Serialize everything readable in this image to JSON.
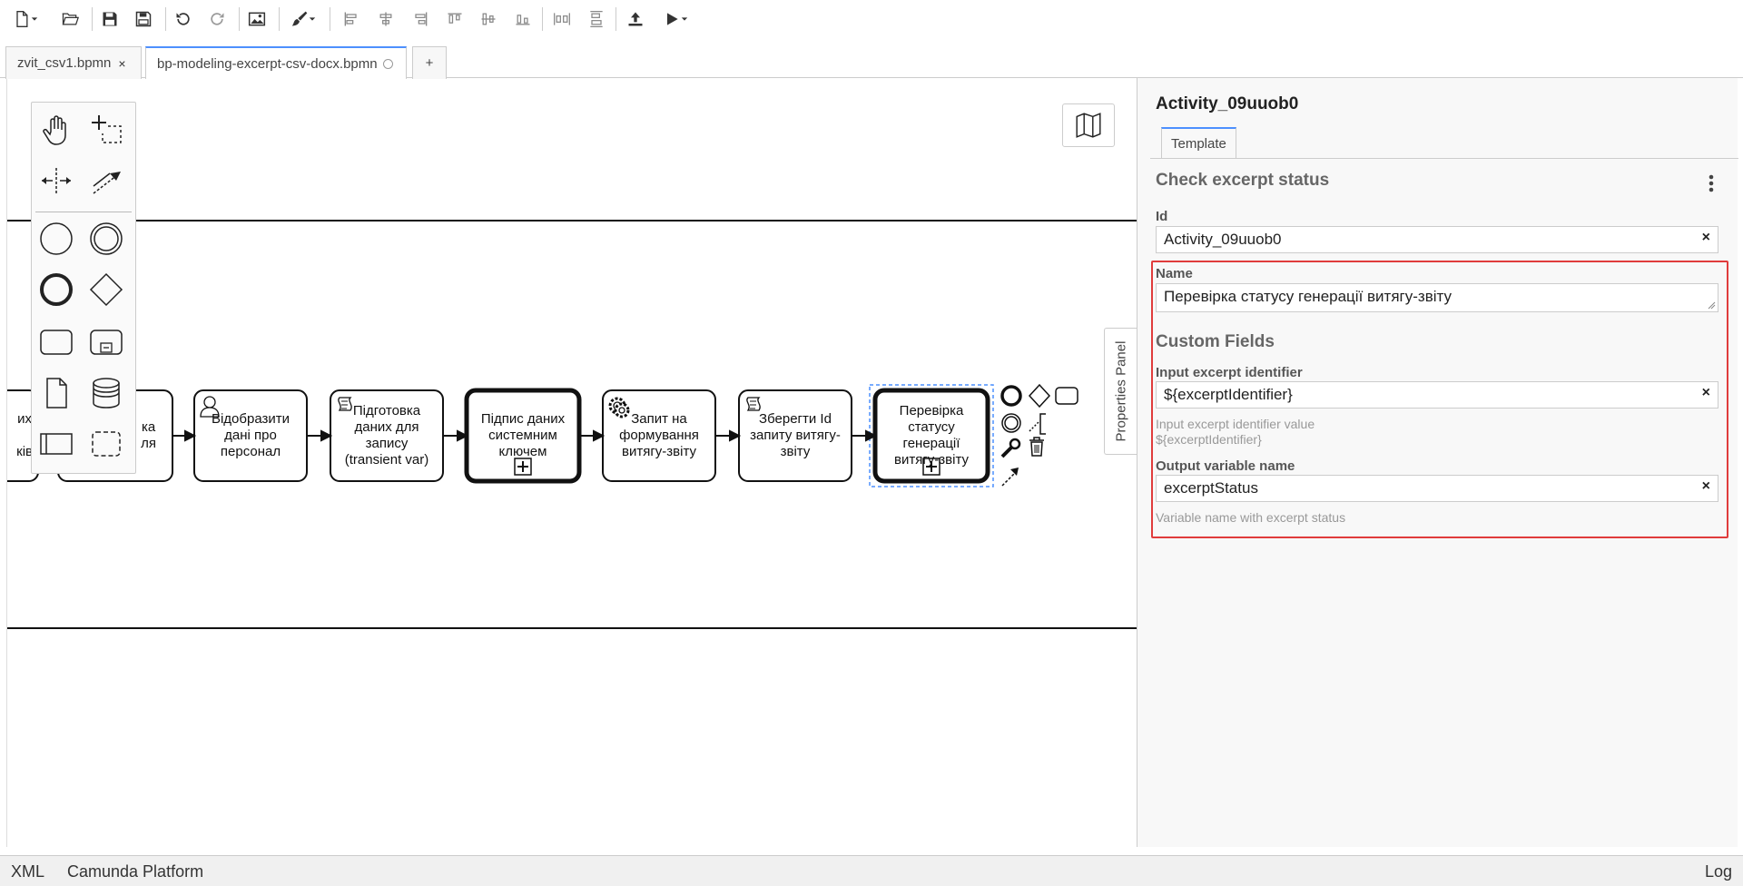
{
  "tabs": [
    {
      "label": "zvit_csv1.bpmn"
    },
    {
      "label": "bp-modeling-excerpt-csv-docx.bpmn"
    }
  ],
  "add_tab_label": "+",
  "diagram": {
    "tasks": [
      {
        "label": "их\n\nків"
      },
      {
        "label": "ка\nля"
      },
      {
        "label": "Відобразити\nдані про\nперсонал"
      },
      {
        "label": "Підготовка\nданих для\nзапису\n(transient var)"
      },
      {
        "label": "Підпис даних\nсистемним\nключем"
      },
      {
        "label": "Запит на\nформування\nвитягу-звіту"
      },
      {
        "label": "Зберегти Id\nзапиту витягу-\nзвіту"
      },
      {
        "label": "Перевірка\nстатусу\nгенерації\nвитягу-звіту"
      }
    ]
  },
  "properties_tab_label": "Properties Panel",
  "panel": {
    "title": "Activity_09uuob0",
    "tab_label": "Template",
    "group_title": "Check excerpt status",
    "id_label": "Id",
    "id_value": "Activity_09uuob0",
    "name_label": "Name",
    "name_value": "Перевірка статусу генерації витягу-звіту",
    "custom_group_title": "Custom Fields",
    "input_label": "Input excerpt identifier",
    "input_value": "${excerptIdentifier}",
    "input_desc_1": "Input excerpt identifier value",
    "input_desc_2": "${excerptIdentifier}",
    "output_label": "Output variable name",
    "output_value": "excerptStatus",
    "output_desc": "Variable name with excerpt status",
    "clear_glyph": "×"
  },
  "statusbar": {
    "xml": "XML",
    "platform": "Camunda Platform",
    "log": "Log"
  },
  "colors": {
    "accent": "#4d90fe",
    "highlight": "#e03c3c"
  }
}
